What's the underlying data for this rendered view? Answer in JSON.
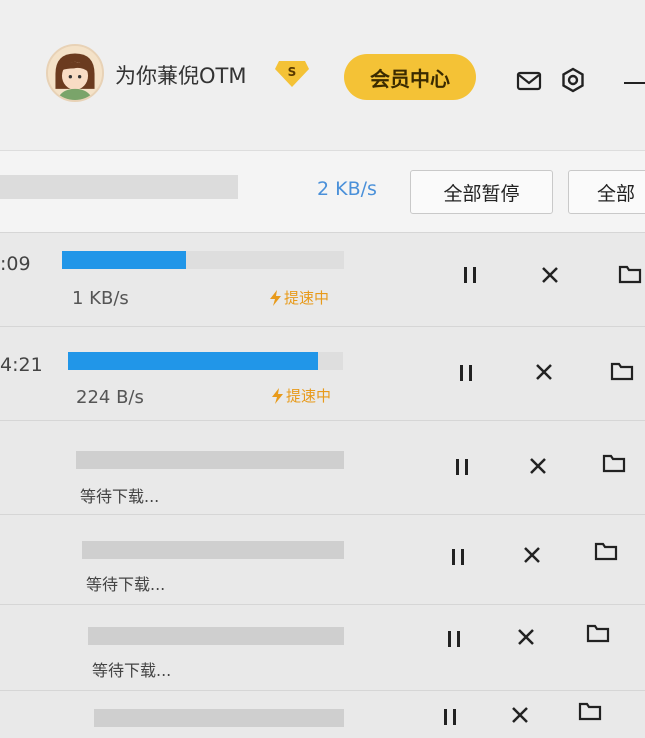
{
  "header": {
    "username": "为你蒹倪OTM",
    "svip_badge": "S",
    "vip_center_label": "会员中心",
    "icons": [
      "avatar",
      "svip-badge-icon",
      "mail-icon",
      "settings-icon",
      "minimize-icon"
    ]
  },
  "toolbar": {
    "total_speed": "2 KB/s",
    "pause_all_label": "全部暂停",
    "more_label": "全部"
  },
  "downloads": [
    {
      "time": ":09",
      "progress": 0.44,
      "speed": "1 KB/s",
      "boost": "提速中"
    },
    {
      "time": "4:21",
      "progress": 0.91,
      "speed": "224 B/s",
      "boost": "提速中"
    },
    {
      "status": "等待下载..."
    },
    {
      "status": "等待下载..."
    },
    {
      "status": "等待下载..."
    },
    {
      "status": ""
    }
  ],
  "colors": {
    "accent_blue": "#2196e8",
    "vip_gold": "#f4c236",
    "boost_orange": "#e89a1a",
    "speed_blue": "#4a90d9"
  }
}
